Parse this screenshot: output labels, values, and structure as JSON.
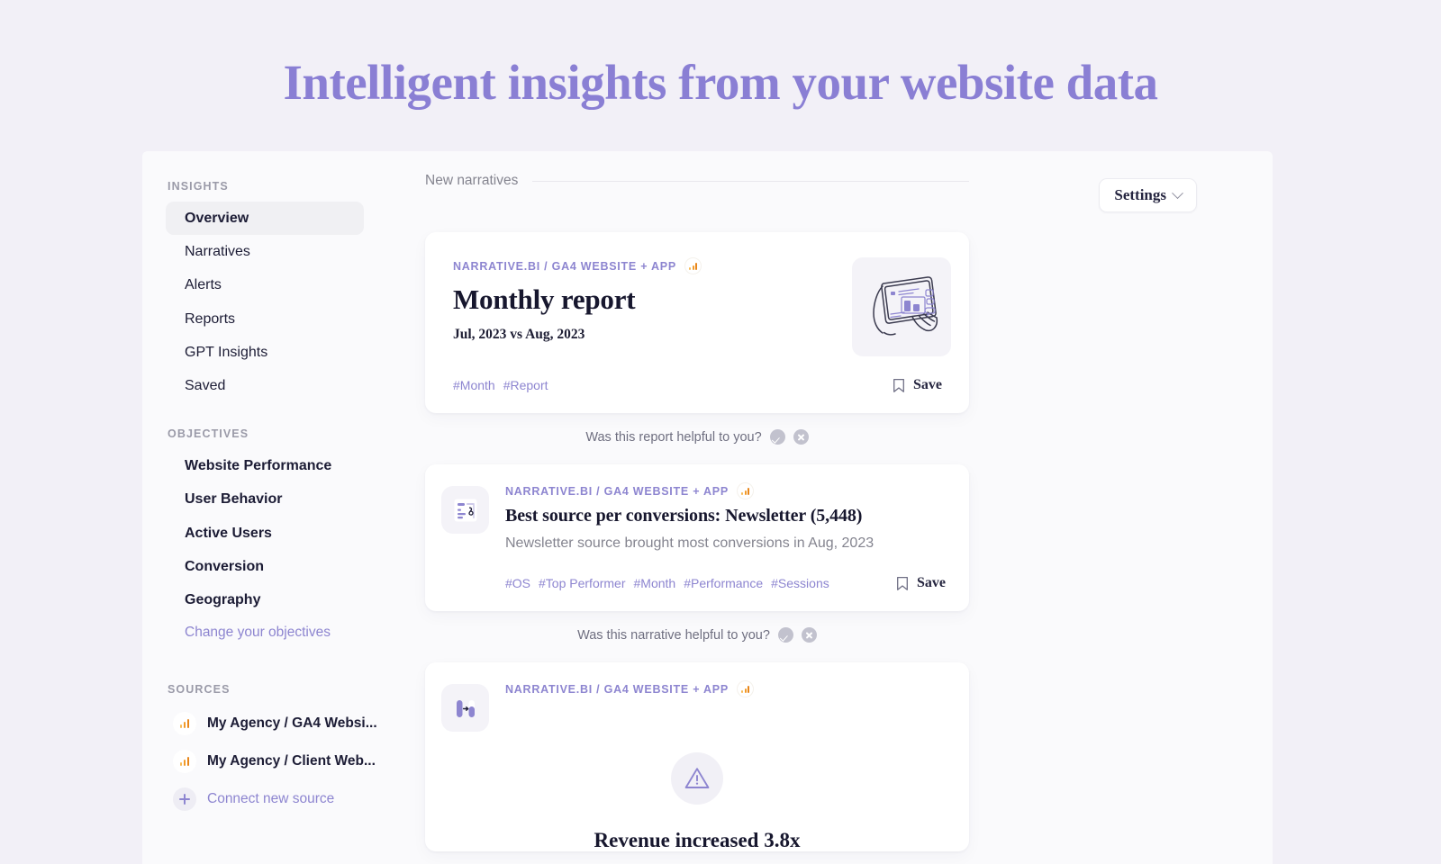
{
  "headline": "Intelligent insights from your website data",
  "sidebar": {
    "groups": [
      {
        "label": "INSIGHTS",
        "items": [
          {
            "label": "Overview",
            "active": true
          },
          {
            "label": "Narratives",
            "active": false
          },
          {
            "label": "Alerts",
            "active": false
          },
          {
            "label": "Reports",
            "active": false
          },
          {
            "label": "GPT Insights",
            "active": false
          },
          {
            "label": "Saved",
            "active": false
          }
        ]
      },
      {
        "label": "OBJECTIVES",
        "items": [
          {
            "label": "Website Performance"
          },
          {
            "label": "User Behavior"
          },
          {
            "label": "Active Users"
          },
          {
            "label": "Conversion"
          },
          {
            "label": "Geography"
          }
        ],
        "link": "Change your objectives"
      },
      {
        "label": "SOURCES",
        "sources": [
          {
            "label": "My Agency / GA4 Websi...",
            "icon": "ga4-bars-icon"
          },
          {
            "label": "My Agency / Client Web...",
            "icon": "ga4-bars-icon"
          }
        ],
        "connect": "Connect new source"
      }
    ]
  },
  "main": {
    "section_label": "New narratives",
    "settings_label": "Settings",
    "cards": [
      {
        "eyebrow": "NARRATIVE.BI / GA4 WEBSITE + APP",
        "source_icon": "ga4-bars-icon",
        "title": "Monthly report",
        "subtitle": "Jul, 2023 vs Aug, 2023",
        "thumb_icon": "hand-holding-tablet-illustration",
        "tags": [
          "#Month",
          "#Report"
        ],
        "save_label": "Save",
        "save_icon": "bookmark-icon",
        "feedback": {
          "question": "Was this report helpful to you?",
          "yes_icon": "check-circle-icon",
          "no_icon": "x-circle-icon"
        }
      },
      {
        "eyebrow": "NARRATIVE.BI / GA4 WEBSITE + APP",
        "source_icon": "ga4-bars-icon",
        "tile_icon": "article-insight-icon",
        "title": "Best source per conversions: Newsletter (5,448)",
        "description": "Newsletter source brought most conversions in Aug, 2023",
        "tags": [
          "#OS",
          "#Top Performer",
          "#Month",
          "#Performance",
          "#Sessions"
        ],
        "save_label": "Save",
        "save_icon": "bookmark-icon",
        "feedback": {
          "question": "Was this narrative helpful to you?",
          "yes_icon": "check-circle-icon",
          "no_icon": "x-circle-icon"
        }
      },
      {
        "eyebrow": "NARRATIVE.BI / GA4 WEBSITE + APP",
        "source_icon": "ga4-bars-icon",
        "tile_icon": "comparison-bars-icon",
        "status_icon": "warning-triangle-icon",
        "title": "Revenue increased 3.8x"
      }
    ]
  },
  "colors": {
    "page_background": "#f2f0f7",
    "panel_background": "#fafafc",
    "accent_purple": "#8d85d0",
    "headline_purple": "#8a7fd4",
    "text_dark": "#1c1c35",
    "text_muted": "#84848f",
    "ga4_orange": "#e8861a",
    "card_white": "#ffffff"
  }
}
